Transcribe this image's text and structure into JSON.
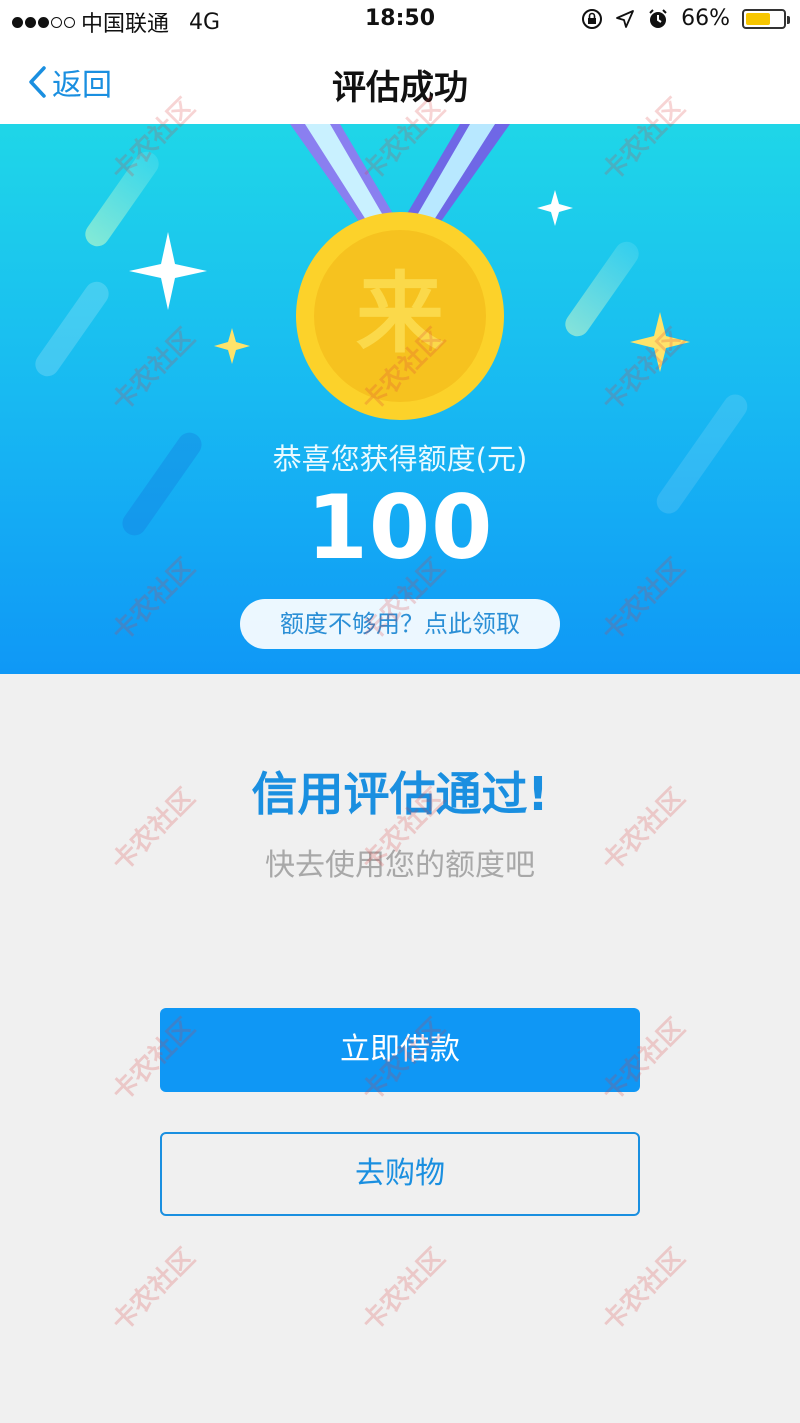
{
  "status_bar": {
    "carrier": "中国联通",
    "network": "4G",
    "time": "18:50",
    "battery": "66%",
    "battery_level": 0.66
  },
  "nav": {
    "back_label": "返回",
    "title": "评估成功"
  },
  "banner": {
    "medal_char": "来",
    "caption": "恭喜您获得额度(元)",
    "amount": "100",
    "quota_button_label": "额度不够用？点此领取"
  },
  "content": {
    "headline": "信用评估通过!",
    "subline": "快去使用您的额度吧"
  },
  "actions": {
    "borrow_label": "立即借款",
    "shop_label": "去购物"
  },
  "watermark_text": "卡农社区",
  "colors": {
    "accent": "#1a8fe0",
    "primary_button": "#0f97f5",
    "battery": "#f7c600",
    "medal_gold": "#fcd22a"
  }
}
